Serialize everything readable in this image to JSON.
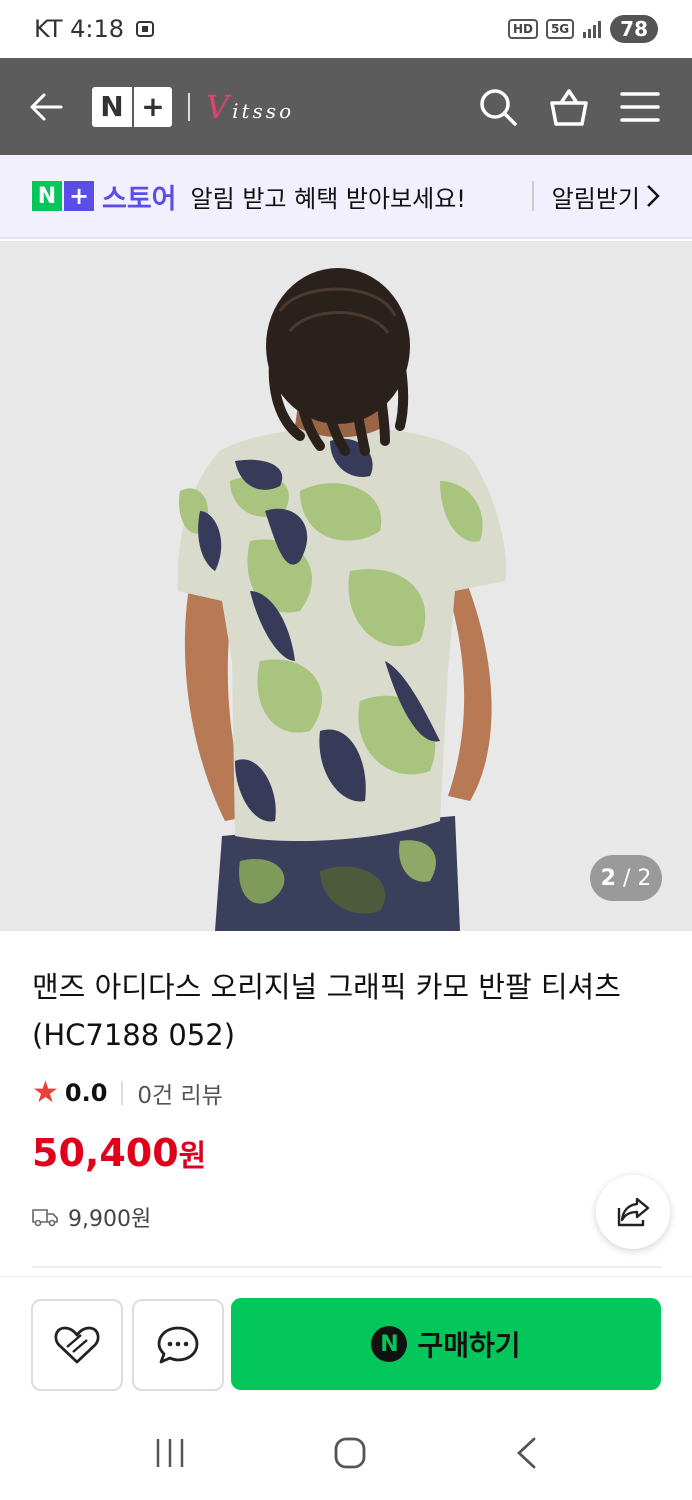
{
  "status_bar": {
    "carrier_time": "KT 4:18",
    "hd": "HD",
    "network": "5G",
    "battery": "78"
  },
  "header": {
    "logo_n": "N",
    "logo_plus": "+",
    "brand": "itsso",
    "brand_initial": "V"
  },
  "promo": {
    "store": "스토어",
    "text": "알림 받고 혜택 받아보세요!",
    "link": "알림받기"
  },
  "image": {
    "counter_current": "2",
    "counter_total": "2"
  },
  "product": {
    "title": "맨즈 아디다스 오리지널 그래픽 카모 반팔 티셔츠 (HC7188 052)",
    "rating": "0.0",
    "reviews": "0건 리뷰",
    "price": "50,400",
    "price_unit": "원",
    "shipping": "9,900원"
  },
  "bottom": {
    "buy_label": "구매하기",
    "npay": "N"
  },
  "colors": {
    "header_bg": "#5c5c5c",
    "promo_bg": "#f2f0fd",
    "accent_purple": "#5b4ee8",
    "naver_green": "#03c75a",
    "price_red": "#e0001c",
    "star": "#e8403a"
  }
}
